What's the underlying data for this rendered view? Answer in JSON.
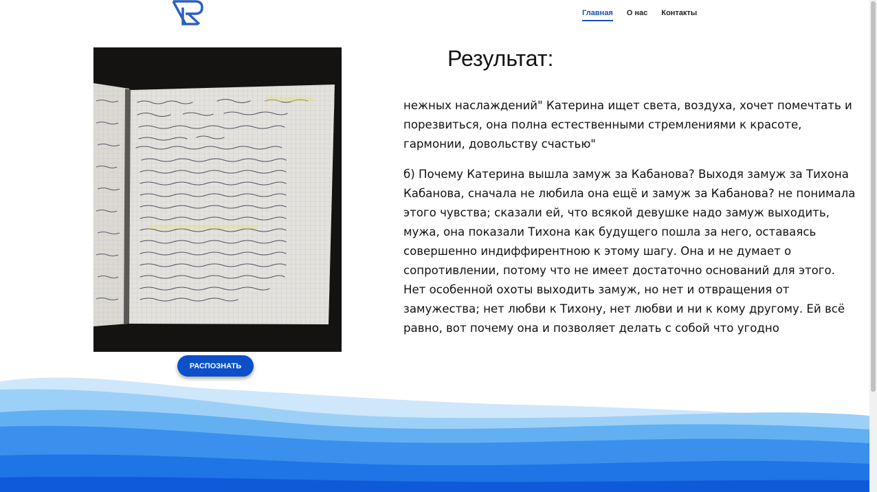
{
  "header": {
    "logo_icon": "rp-monogram-logo",
    "nav": [
      {
        "label": "Главная",
        "active": true
      },
      {
        "label": "О нас",
        "active": false
      },
      {
        "label": "Контакты",
        "active": false
      }
    ]
  },
  "main": {
    "recognize_button": "РАСПОЗНАТЬ",
    "result_title": "Результат:",
    "result_paragraphs": [
      "нежных наслаждений\" Катерина ищет света, воздуха, хочет помечтать и порезвиться, она полна естественными стремлениями к красоте, гармонии, довольству счастью\"",
      "б) Почему Катерина вышла замуж за Кабанова? Выходя замуж за Тихона Кабанова, сначала не любила она ещё и замуж за Кабанова? не понимала этого чувства; сказали ей, что всякой девушке надо замуж выходить, мужа, она показали Тихона как будущего пошла за него, оставаясь совершенно индиффирентною к этому шагу. Она и не думает о сопротивлении, потому что не имеет достаточно оснований для этого. Нет особенной охоты выходить замуж, но нет и отвращения от замужества; нет любви к Тихону, нет любви и ни к кому другому. Ей всё равно, вот почему она и позволяет делать с собой что угодно"
    ]
  },
  "colors": {
    "accent": "#0b4fc9",
    "nav_active": "#1b4fb5",
    "wave_light": "#bfe0fb",
    "wave_mid": "#7fc0f4",
    "wave_blue": "#3d93ec",
    "wave_dark": "#1a6fe3"
  }
}
